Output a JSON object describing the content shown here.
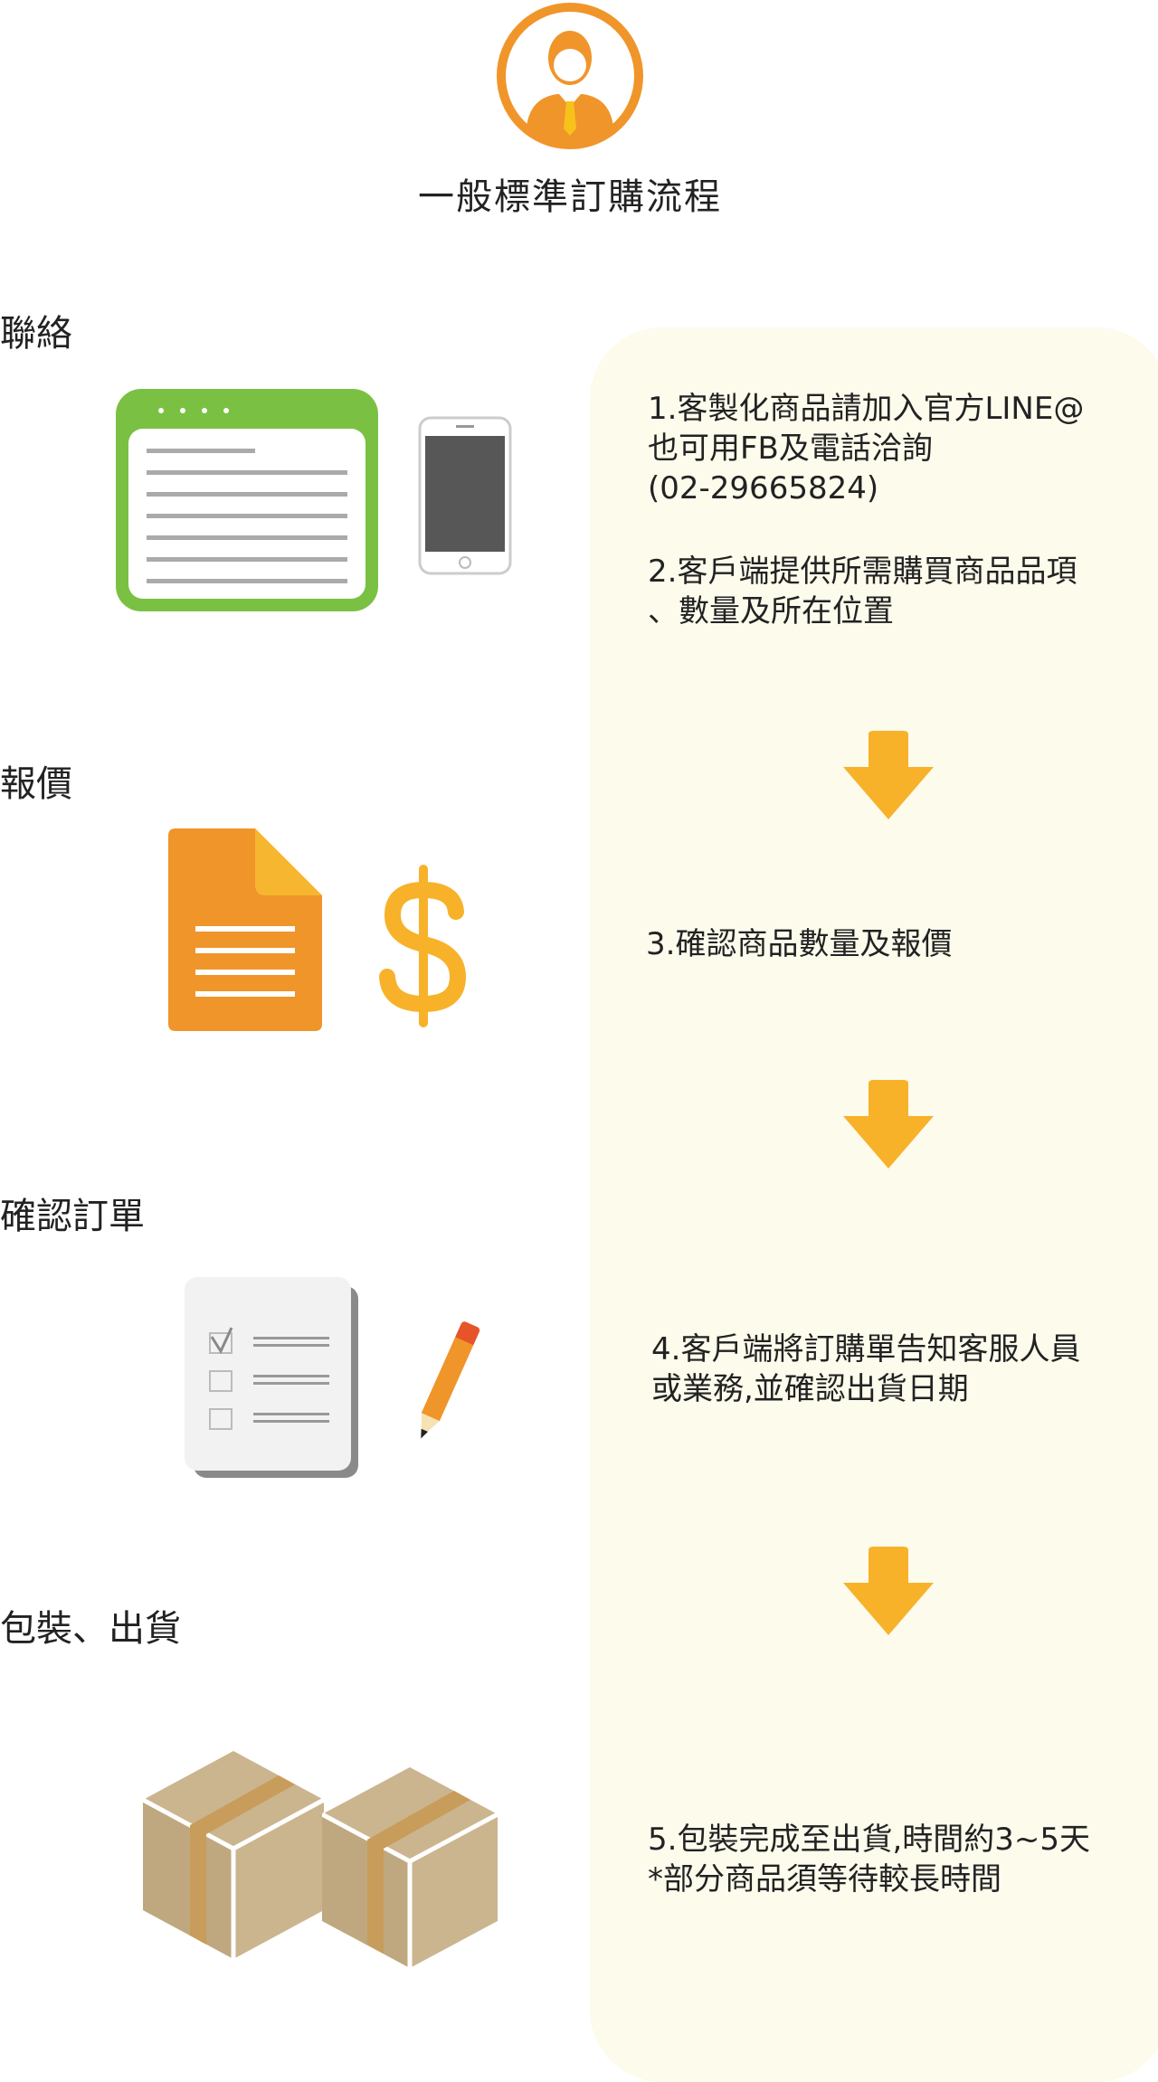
{
  "header": {
    "title": "一般標準訂購流程",
    "icon": "businessman-icon"
  },
  "colors": {
    "orange": "#f0952a",
    "arrow": "#f7b22a",
    "green": "#7ac143",
    "panel": "#fcfbec",
    "box": "#cbb58f"
  },
  "steps": [
    {
      "label": "聯絡",
      "icons": [
        "browser-window-icon",
        "smartphone-icon"
      ]
    },
    {
      "label": "報價",
      "icons": [
        "document-icon",
        "dollar-icon"
      ]
    },
    {
      "label": "確認訂單",
      "icons": [
        "checklist-icon",
        "pencil-icon"
      ]
    },
    {
      "label": "包裝、出貨",
      "icons": [
        "box-icon",
        "box-icon"
      ]
    }
  ],
  "notes": {
    "n1": "1.客製化商品請加入官方LINE@\n也可用FB及電話洽詢\n(02-29665824)",
    "n2": "2.客戶端提供所需購買商品品項\n、數量及所在位置",
    "n3": "3.確認商品數量及報價",
    "n4": "4.客戶端將訂購單告知客服人員\n或業務,並確認出貨日期",
    "n5": "5.包裝完成至出貨,時間約3~5天\n*部分商品須等待較長時間"
  }
}
